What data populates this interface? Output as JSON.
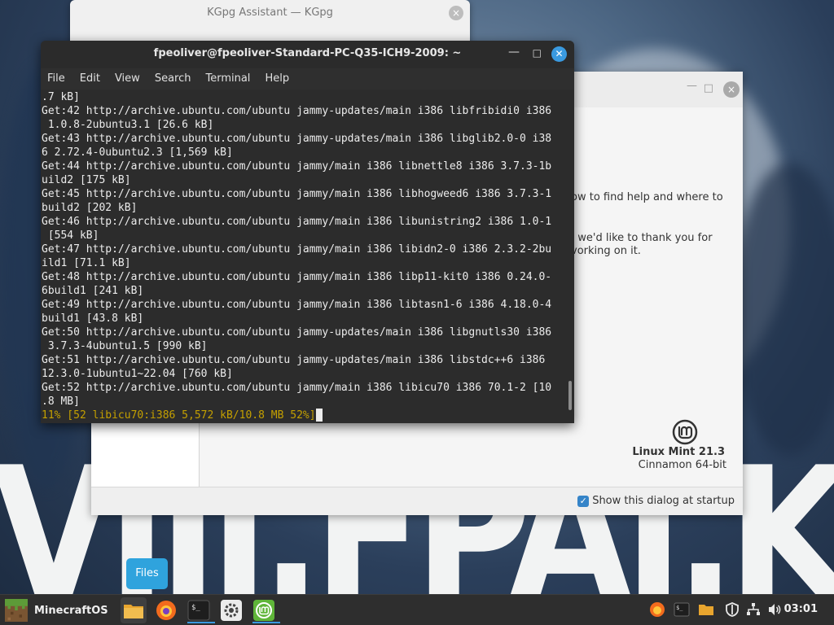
{
  "kgpg": {
    "title": "KGpg Assistant — KGpg",
    "close_icon": "×"
  },
  "welcome": {
    "minimize_icon": "□",
    "close_icon": "×",
    "para1_line1": "ow to find help and where to",
    "para2_line1": ", we'd like to thank you for",
    "para2_line2": "vorking on it.",
    "os_name": "Linux Mint 21.3",
    "os_edition": "Cinnamon 64-bit",
    "startup_label": "Show this dialog at startup",
    "startup_checked": true
  },
  "terminal": {
    "title": "fpeoliver@fpeoliver-Standard-PC-Q35-ICH9-2009: ~",
    "menu": [
      "File",
      "Edit",
      "View",
      "Search",
      "Terminal",
      "Help"
    ],
    "lines": [
      ".7 kB]",
      "Get:42 http://archive.ubuntu.com/ubuntu jammy-updates/main i386 libfribidi0 i386",
      " 1.0.8-2ubuntu3.1 [26.6 kB]",
      "Get:43 http://archive.ubuntu.com/ubuntu jammy-updates/main i386 libglib2.0-0 i38",
      "6 2.72.4-0ubuntu2.3 [1,569 kB]",
      "Get:44 http://archive.ubuntu.com/ubuntu jammy/main i386 libnettle8 i386 3.7.3-1b",
      "uild2 [175 kB]",
      "Get:45 http://archive.ubuntu.com/ubuntu jammy/main i386 libhogweed6 i386 3.7.3-1",
      "build2 [202 kB]",
      "Get:46 http://archive.ubuntu.com/ubuntu jammy/main i386 libunistring2 i386 1.0-1",
      " [554 kB]",
      "Get:47 http://archive.ubuntu.com/ubuntu jammy/main i386 libidn2-0 i386 2.3.2-2bu",
      "ild1 [71.1 kB]",
      "Get:48 http://archive.ubuntu.com/ubuntu jammy/main i386 libp11-kit0 i386 0.24.0-",
      "6build1 [241 kB]",
      "Get:49 http://archive.ubuntu.com/ubuntu jammy/main i386 libtasn1-6 i386 4.18.0-4",
      "build1 [43.8 kB]",
      "Get:50 http://archive.ubuntu.com/ubuntu jammy-updates/main i386 libgnutls30 i386",
      " 3.7.3-4ubuntu1.5 [990 kB]",
      "Get:51 http://archive.ubuntu.com/ubuntu jammy-updates/main i386 libstdc++6 i386",
      "12.3.0-1ubuntu1~22.04 [760 kB]",
      "Get:52 http://archive.ubuntu.com/ubuntu jammy/main i386 libicu70 i386 70.1-2 [10",
      ".8 MB]"
    ],
    "progress_line": "11% [52 libicu70:i386 5,572 kB/10.8 MB 52%]"
  },
  "tooltip": {
    "text": "Files"
  },
  "taskbar": {
    "menu_label": "MinecraftOS",
    "pinned": [
      {
        "name": "files-icon",
        "color": "#e8a52e"
      },
      {
        "name": "firefox-icon",
        "color": "#f26b1d"
      },
      {
        "name": "terminal-icon",
        "color": "#2a2a2a"
      },
      {
        "name": "settings-icon",
        "color": "#ececec"
      },
      {
        "name": "mint-update-icon",
        "color": "#5fb539"
      }
    ],
    "clock": "03:01"
  },
  "wallpaper": {
    "text": "VIII.FPAI.K"
  },
  "colors": {
    "accent": "#3a9ae0",
    "terminal_progress": "#c4a000",
    "mint_green": "#5fb539"
  }
}
